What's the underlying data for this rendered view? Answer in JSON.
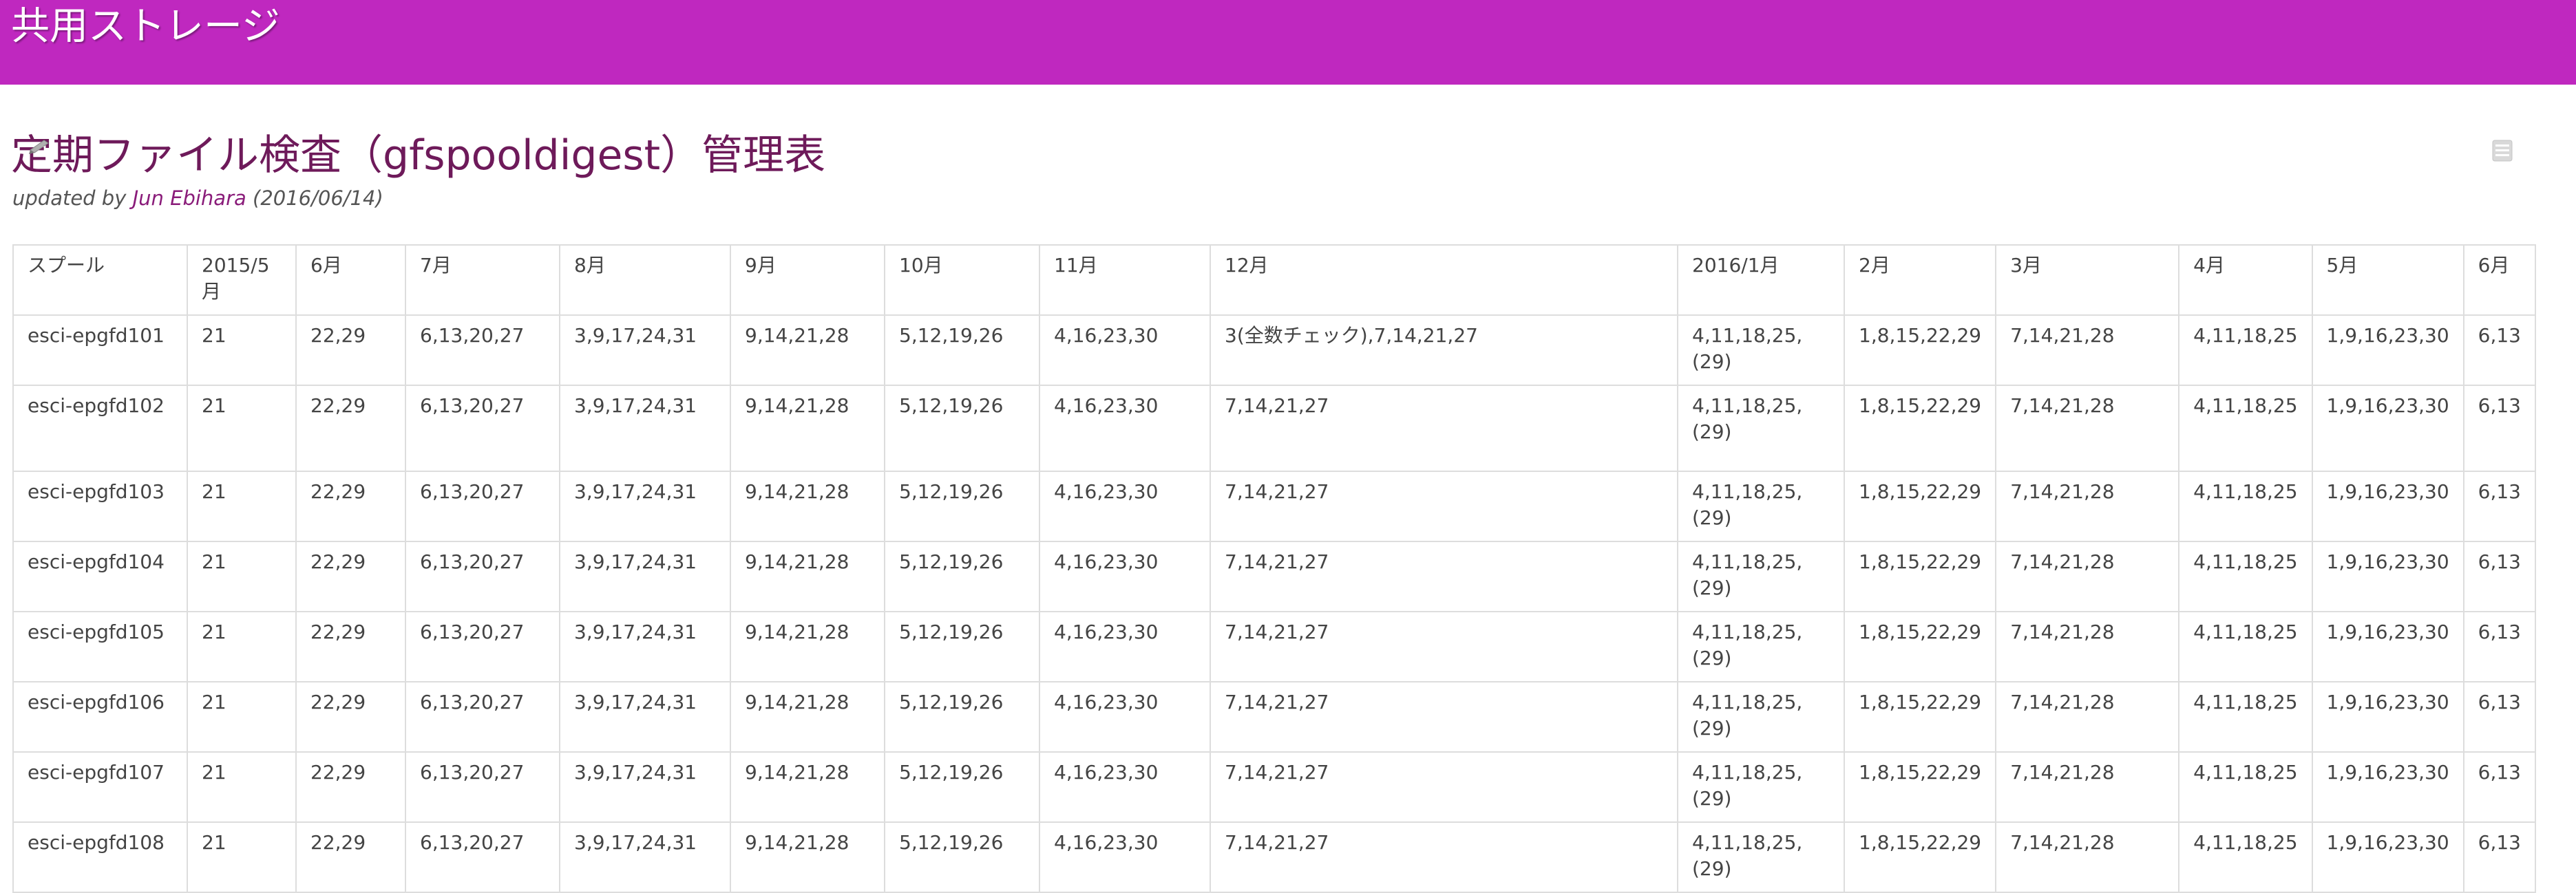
{
  "header": {
    "site_title": "共用ストレージ"
  },
  "page": {
    "title": "定期ファイル検査（gfspooldigest）管理表",
    "updated_prefix": "updated by",
    "author": "Jun Ebihara",
    "updated_date": "(2016/06/14)"
  },
  "table": {
    "columns": [
      "スプール",
      "2015/5月",
      "6月",
      "7月",
      "8月",
      "9月",
      "10月",
      "11月",
      "12月",
      "2016/1月",
      "2月",
      "3月",
      "4月",
      "5月",
      "6月"
    ],
    "rows": [
      [
        "esci-epgfd101",
        "21",
        "22,29",
        "6,13,20,27",
        "3,9,17,24,31",
        "9,14,21,28",
        "5,12,19,26",
        "4,16,23,30",
        "3(全数チェック),7,14,21,27",
        "4,11,18,25,(29)",
        "1,8,15,22,29",
        "7,14,21,28",
        "4,11,18,25",
        "1,9,16,23,30",
        "6,13"
      ],
      [
        "esci-epgfd102",
        "21",
        "22,29",
        "6,13,20,27",
        "3,9,17,24,31",
        "9,14,21,28",
        "5,12,19,26",
        "4,16,23,30",
        "7,14,21,27",
        "4,11,18,25,(29)",
        "1,8,15,22,29",
        "7,14,21,28",
        "4,11,18,25",
        "1,9,16,23,30",
        "6,13"
      ],
      [
        "esci-epgfd103",
        "21",
        "22,29",
        "6,13,20,27",
        "3,9,17,24,31",
        "9,14,21,28",
        "5,12,19,26",
        "4,16,23,30",
        "7,14,21,27",
        "4,11,18,25,(29)",
        "1,8,15,22,29",
        "7,14,21,28",
        "4,11,18,25",
        "1,9,16,23,30",
        "6,13"
      ],
      [
        "esci-epgfd104",
        "21",
        "22,29",
        "6,13,20,27",
        "3,9,17,24,31",
        "9,14,21,28",
        "5,12,19,26",
        "4,16,23,30",
        "7,14,21,27",
        "4,11,18,25,(29)",
        "1,8,15,22,29",
        "7,14,21,28",
        "4,11,18,25",
        "1,9,16,23,30",
        "6,13"
      ],
      [
        "esci-epgfd105",
        "21",
        "22,29",
        "6,13,20,27",
        "3,9,17,24,31",
        "9,14,21,28",
        "5,12,19,26",
        "4,16,23,30",
        "7,14,21,27",
        "4,11,18,25,(29)",
        "1,8,15,22,29",
        "7,14,21,28",
        "4,11,18,25",
        "1,9,16,23,30",
        "6,13"
      ],
      [
        "esci-epgfd106",
        "21",
        "22,29",
        "6,13,20,27",
        "3,9,17,24,31",
        "9,14,21,28",
        "5,12,19,26",
        "4,16,23,30",
        "7,14,21,27",
        "4,11,18,25,(29)",
        "1,8,15,22,29",
        "7,14,21,28",
        "4,11,18,25",
        "1,9,16,23,30",
        "6,13"
      ],
      [
        "esci-epgfd107",
        "21",
        "22,29",
        "6,13,20,27",
        "3,9,17,24,31",
        "9,14,21,28",
        "5,12,19,26",
        "4,16,23,30",
        "7,14,21,27",
        "4,11,18,25,(29)",
        "1,8,15,22,29",
        "7,14,21,28",
        "4,11,18,25",
        "1,9,16,23,30",
        "6,13"
      ],
      [
        "esci-epgfd108",
        "21",
        "22,29",
        "6,13,20,27",
        "3,9,17,24,31",
        "9,14,21,28",
        "5,12,19,26",
        "4,16,23,30",
        "7,14,21,27",
        "4,11,18,25,(29)",
        "1,8,15,22,29",
        "7,14,21,28",
        "4,11,18,25",
        "1,9,16,23,30",
        "6,13"
      ]
    ]
  },
  "icons": {
    "edit": "pencil-icon",
    "menu": "list-menu-icon"
  },
  "colors": {
    "header_bg": "#bf28bf",
    "title": "#6e1a5a",
    "link": "#8a1c7a",
    "border": "#dddddd"
  }
}
